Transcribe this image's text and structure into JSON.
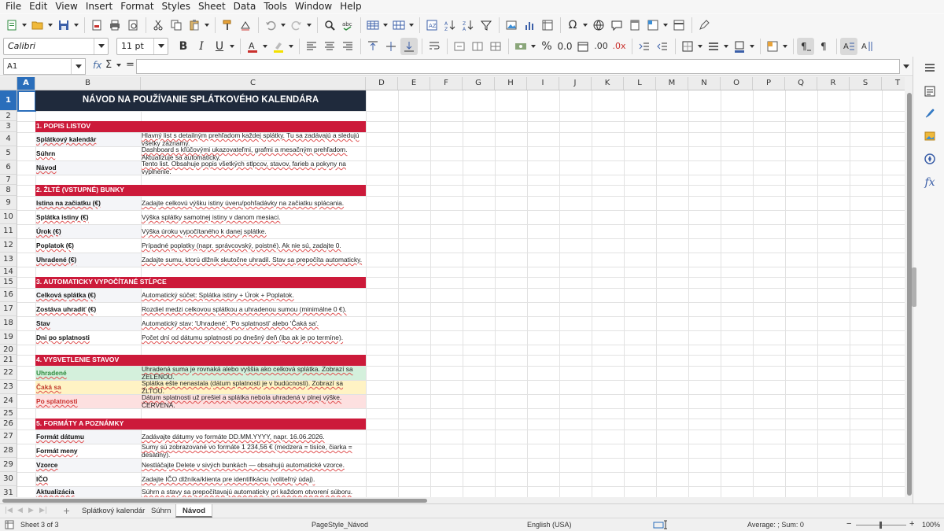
{
  "menu": [
    "File",
    "Edit",
    "View",
    "Insert",
    "Format",
    "Styles",
    "Sheet",
    "Data",
    "Tools",
    "Window",
    "Help"
  ],
  "font": {
    "name": "Calibri",
    "size": "11 pt"
  },
  "namebox": "A1",
  "formula": {
    "fx": "fx",
    "sigma": "Σ",
    "eq": "="
  },
  "columns": {
    "A": "A",
    "B": "B",
    "C": "C",
    "D": "D",
    "E": "E",
    "F": "F",
    "G": "G",
    "H": "H",
    "I": "I",
    "J": "J",
    "K": "K",
    "L": "L",
    "M": "M",
    "N": "N",
    "O": "O",
    "P": "P",
    "Q": "Q",
    "R": "R",
    "S": "S",
    "T": "T"
  },
  "rows": {
    "r1": "1",
    "r2": "2",
    "r3": "3",
    "r4": "4",
    "r5": "5",
    "r6": "6",
    "r7": "7",
    "r8": "8",
    "r9": "9",
    "r10": "10",
    "r11": "11",
    "r12": "12",
    "r13": "13",
    "r14": "14",
    "r15": "15",
    "r16": "16",
    "r17": "17",
    "r18": "18",
    "r19": "19",
    "r20": "20",
    "r21": "21",
    "r22": "22",
    "r23": "23",
    "r24": "24",
    "r25": "25",
    "r26": "26",
    "r27": "27",
    "r28": "28",
    "r29": "29",
    "r30": "30",
    "r31": "31"
  },
  "sheet": {
    "title": "NÁVOD NA POUŽÍVANIE SPLÁTKOVÉHO KALENDÁRA",
    "s1": "1. POPIS LISTOV",
    "r4b": "Splátkový kalendár",
    "r4c": "Hlavný list s detailným prehľadom každej splátky. Tu sa zadávajú a sledujú všetky záznamy.",
    "r5b": "Súhrn",
    "r5c": "Dashboard s kľúčovými ukazovateľmi, grafmi a mesačným prehľadom. Aktualizuje sa automaticky.",
    "r6b": "Návod",
    "r6c": "Tento list. Obsahuje popis všetkých stĺpcov, stavov, farieb a pokyny na vyplnenie.",
    "s2": "2. ŽLTÉ (VSTUPNÉ) BUNKY",
    "r9b": "Istina na začiatku (€)",
    "r9c": "Zadajte celkovú výšku istiny úveru/pohľadávky na začiatku splácania.",
    "r10b": "Splátka istiny (€)",
    "r10c": "Výška splátky samotnej istiny v danom mesiaci.",
    "r11b": "Úrok (€)",
    "r11c": "Výška úroku vypočítaného k danej splátke.",
    "r12b": "Poplatok (€)",
    "r12c": "Prípadné poplatky (napr. správcovský, poistné). Ak nie sú, zadajte 0.",
    "r13b": "Uhradené (€)",
    "r13c": "Zadajte sumu, ktorú dlžník skutočne uhradil. Stav sa prepočíta automaticky.",
    "s3": "3. AUTOMATICKY VYPOČÍTANÉ STĹPCE",
    "r16b": "Celková splátka (€)",
    "r16c": "Automatický súčet: Splátka istiny + Úrok + Poplatok.",
    "r17b": "Zostáva uhradiť (€)",
    "r17c": "Rozdiel medzi celkovou splátkou a uhradenou sumou (minimálne 0 €).",
    "r18b": "Stav",
    "r18c": "Automatický stav: 'Uhradené', 'Po splatnosti' alebo 'Čaká sa'.",
    "r19b": "Dni po splatnosti",
    "r19c": "Počet dní od dátumu splatnosti po dnešný deň (iba ak je po termíne).",
    "s4": "4. VYSVETLENIE STAVOV",
    "r22b": "Uhradené",
    "r22c": "Uhradená suma je rovnaká alebo vyššia ako celková splátka. Zobrazí sa ZELENOU.",
    "r23b": "Čaká sa",
    "r23c": "Splátka ešte nenastala (dátum splatnosti je v budúcnosti). Zobrazí sa ŽLTOU.",
    "r24b": "Po splatnosti",
    "r24c": "Dátum splatnosti už prešiel a splátka nebola uhradená v plnej výške. ČERVENÁ.",
    "s5": "5. FORMÁTY A POZNÁMKY",
    "r27b": "Formát dátumu",
    "r27c": "Zadávajte dátumy vo formáte DD.MM.YYYY, napr. 16.06.2026.",
    "r28b": "Formát meny",
    "r28c": "Sumy sú zobrazované vo formáte 1 234,56 € (medzera = tisíce, čiarka = desatiny).",
    "r29b": "Vzorce",
    "r29c": "Nestláčajte Delete v sivých bunkách — obsahujú automatické vzorce.",
    "r30b": "IČO",
    "r30c": "Zadajte IČO dlžníka/klienta pre identifikáciu (voliteľný údaj).",
    "r31b": "Aktualizácia",
    "r31c": "Súhrn a stavy sa prepočítavajú automaticky pri každom otvorení súboru."
  },
  "colors": {
    "section_red": "#cc1a3a",
    "title_bg": "#1f2a3c",
    "paid_green": "#d4f0dc",
    "waiting_yellow": "#fff3c4",
    "overdue_pink": "#fde0e0",
    "selection_blue": "#2a6ebb"
  },
  "tabs": {
    "t1": "Splátkový kalendár",
    "t2": "Súhrn",
    "t3": "Návod"
  },
  "status": {
    "sheet": "Sheet 3 of 3",
    "pagestyle": "PageStyle_Návod",
    "lang": "English (USA)",
    "sum": "Average: ; Sum: 0",
    "zoom": "100%"
  }
}
